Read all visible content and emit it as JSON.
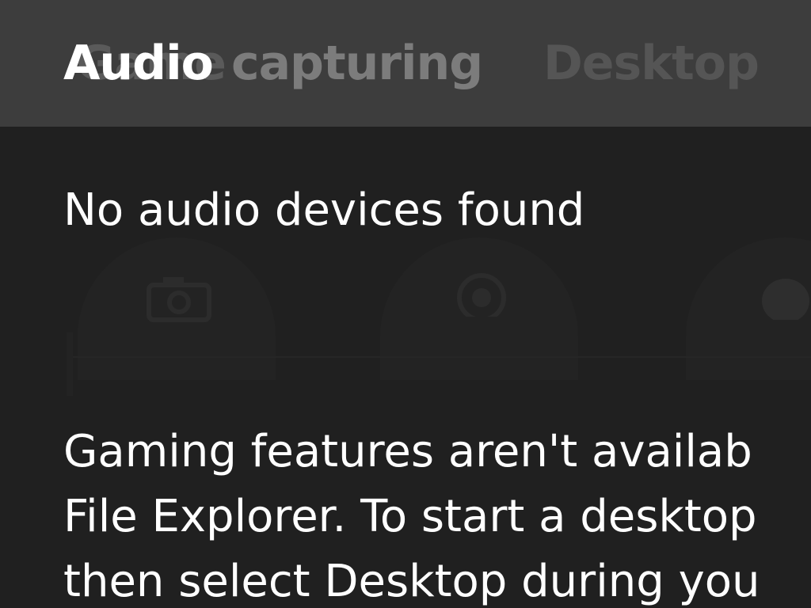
{
  "header": {
    "title": "Audio",
    "ghost_tabs": [
      "Game",
      "capturing",
      "Desktop"
    ]
  },
  "main": {
    "message": "No audio devices found",
    "description_lines": [
      "Gaming features aren't availab",
      "File Explorer. To start a desktop",
      "then select Desktop during you"
    ]
  },
  "icons": {
    "ghost_icons": [
      "camera-icon",
      "record-icon",
      "mic-icon"
    ]
  },
  "colors": {
    "header_bg": "#3d3d3d",
    "page_bg": "#202020",
    "text": "#ffffff"
  }
}
